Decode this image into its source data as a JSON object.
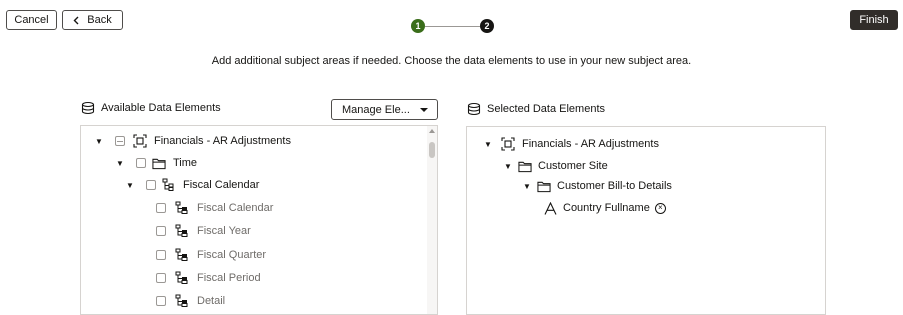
{
  "toolbar": {
    "cancel_label": "Cancel",
    "back_label": "Back",
    "finish_label": "Finish"
  },
  "stepper": {
    "steps": [
      "1",
      "2"
    ],
    "current": 1
  },
  "instructions": "Add additional subject areas if needed. Choose the data elements to use in your new subject area.",
  "available": {
    "title": "Available Data Elements",
    "manage_label": "Manage Ele...",
    "tree": [
      {
        "label": "Financials - AR Adjustments"
      },
      {
        "label": "Time"
      },
      {
        "label": "Fiscal Calendar"
      },
      {
        "label": "Fiscal Calendar"
      },
      {
        "label": "Fiscal Year"
      },
      {
        "label": "Fiscal Quarter"
      },
      {
        "label": "Fiscal Period"
      },
      {
        "label": "Detail"
      }
    ]
  },
  "selected": {
    "title": "Selected Data Elements",
    "tree": [
      {
        "label": "Financials - AR Adjustments"
      },
      {
        "label": "Customer Site"
      },
      {
        "label": "Customer Bill-to Details"
      },
      {
        "label": "Country Fullname"
      }
    ]
  },
  "colors": {
    "step_active": "#3a6d1a",
    "step_pending": "#161513",
    "finish_bg": "#312d2a"
  }
}
